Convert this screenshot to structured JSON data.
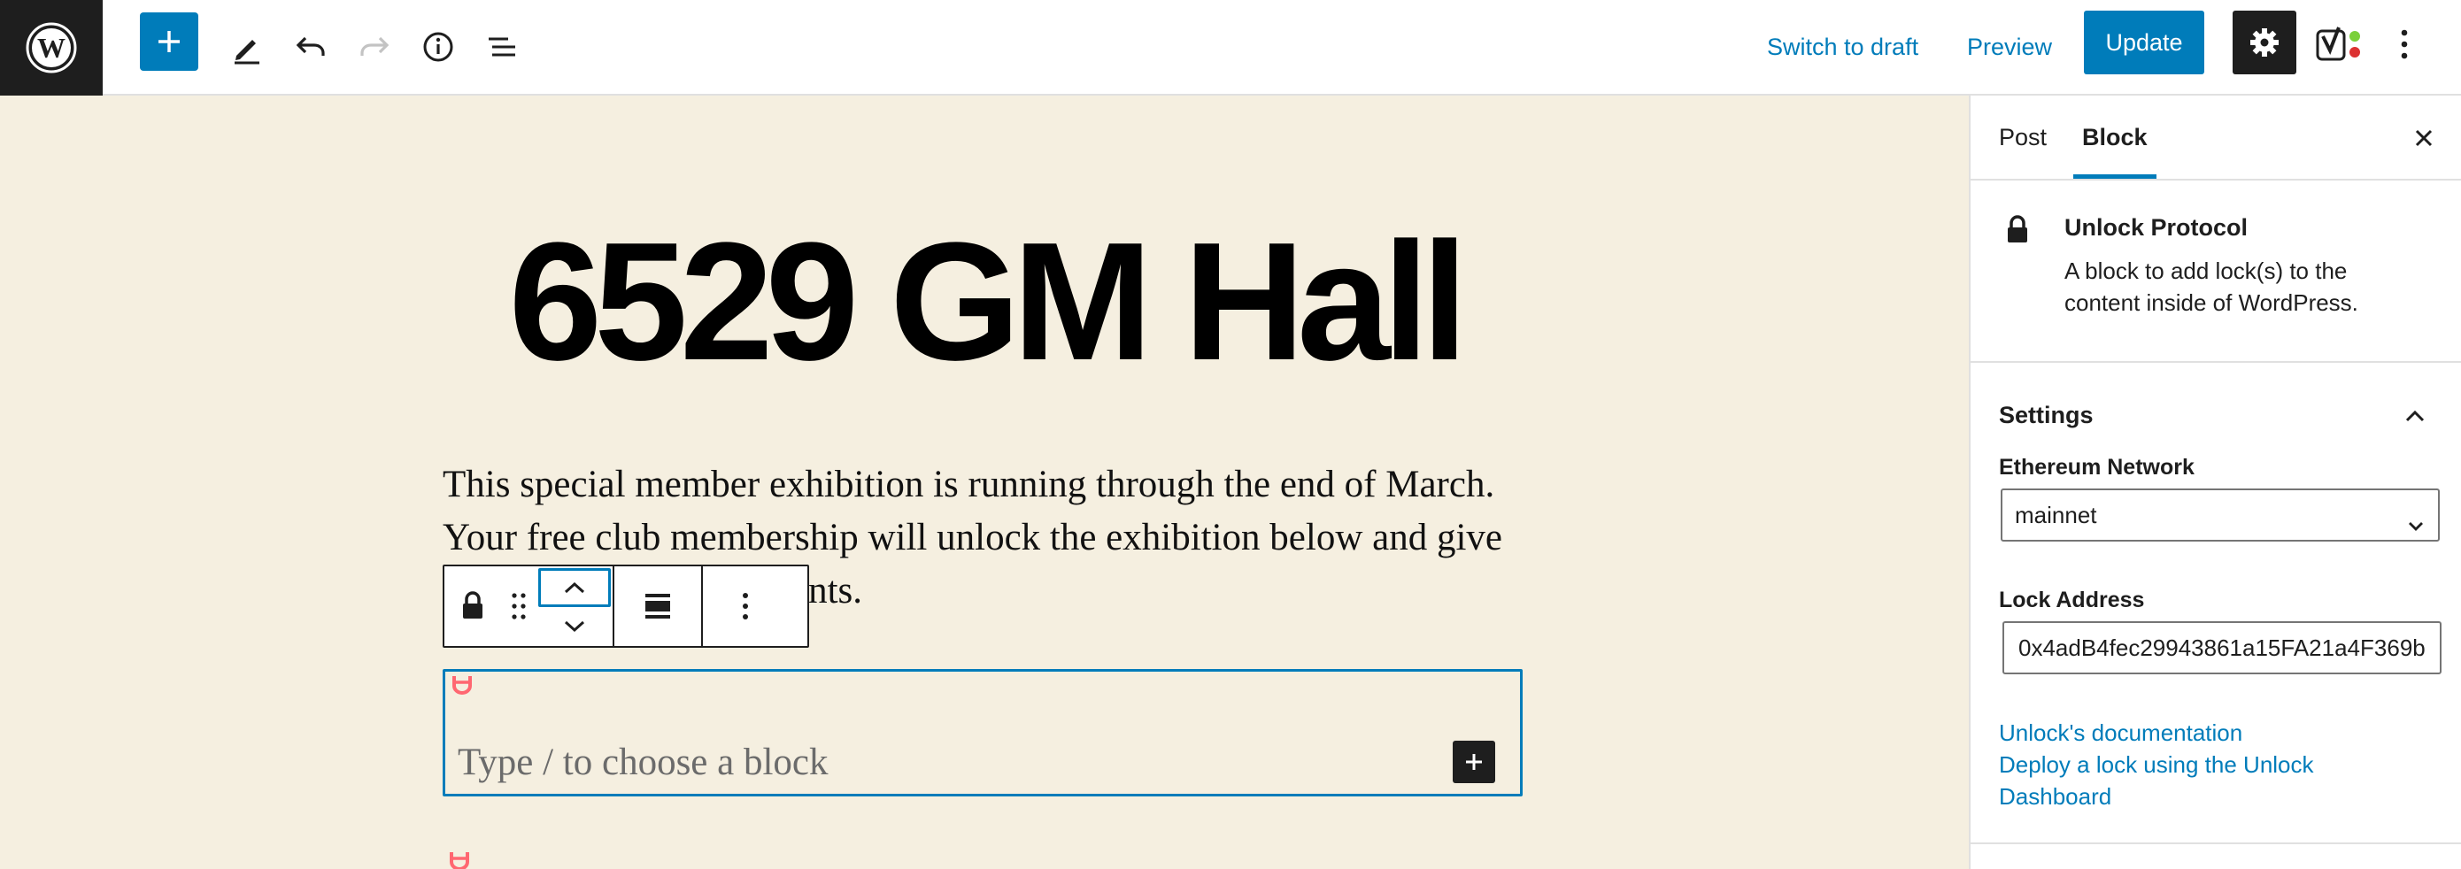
{
  "toolbar": {
    "switch_to_draft": "Switch to draft",
    "preview": "Preview",
    "update": "Update"
  },
  "editor": {
    "post_title": "6529 GM Hall",
    "paragraph": "This special member exhibition is running through the end of March. Your free club membership will unlock the exhibition below and give you access to future events.",
    "appender_placeholder": "Type / to choose a block"
  },
  "sidebar": {
    "tabs": [
      "Post",
      "Block"
    ],
    "active_tab": "Block",
    "block": {
      "title": "Unlock Protocol",
      "description": "A block to add lock(s) to the content inside of WordPress."
    },
    "settings": {
      "heading": "Settings",
      "network_label": "Ethereum Network",
      "network_value": "mainnet",
      "lock_address_label": "Lock Address",
      "lock_address_value": "0x4adB4fec29943861a15FA21a4F369b"
    },
    "links": {
      "documentation": "Unlock's documentation",
      "deploy_line1": "Deploy a lock using the Unlock",
      "deploy_line2": "Dashboard"
    }
  },
  "colors": {
    "accent": "#007cba",
    "canvas_bg": "#f5efe0",
    "dark": "#1e1e1e",
    "unlock_icon": "#ff6771"
  },
  "icons": [
    "wordpress-logo",
    "plus-icon",
    "pencil-icon",
    "undo-icon",
    "redo-icon",
    "info-icon",
    "list-view-icon",
    "gear-icon",
    "yoast-icon",
    "more-vertical-icon",
    "lock-icon",
    "drag-handle-icon",
    "chevron-up-icon",
    "chevron-down-icon",
    "align-icon",
    "close-icon",
    "unlock-logo-icon"
  ]
}
